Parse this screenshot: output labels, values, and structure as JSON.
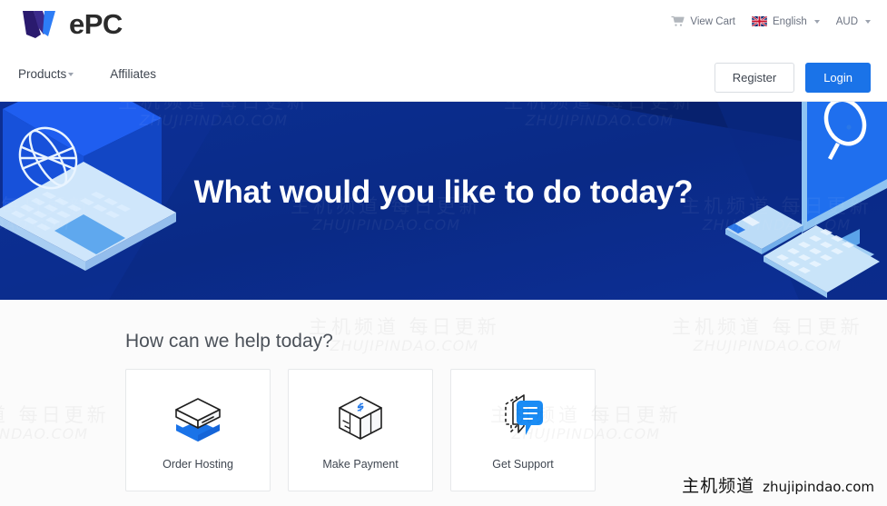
{
  "brand": {
    "logo_mark": "wepc-w-mark",
    "logo_text": "ePC",
    "accent_blue": "#1a73e8",
    "logo_purple": "#2a1a6e",
    "logo_blue": "#2d7df6"
  },
  "topbar": {
    "cart": {
      "icon": "cart-icon",
      "label": "View Cart"
    },
    "language": {
      "icon": "uk-flag-icon",
      "label": "English",
      "caret": "chevron-down-icon"
    },
    "currency": {
      "label": "AUD",
      "caret": "chevron-down-icon"
    }
  },
  "nav": {
    "links": [
      {
        "label": "Products",
        "has_caret": true
      },
      {
        "label": "Affiliates",
        "has_caret": false
      }
    ],
    "register_label": "Register",
    "login_label": "Login"
  },
  "hero": {
    "title": "What would you like to do today?",
    "background_color": "#0b2a8a",
    "left_art": "isometric-laptop-globe",
    "right_art": "isometric-desktop-search"
  },
  "main": {
    "section_title": "How can we help today?",
    "cards": [
      {
        "label": "Order Hosting",
        "icon": "server-box-icon"
      },
      {
        "label": "Make Payment",
        "icon": "cash-stack-icon"
      },
      {
        "label": "Get Support",
        "icon": "chat-bubbles-icon"
      }
    ]
  },
  "watermark": {
    "cn": "主机频道 每日更新",
    "en": "ZHUJIPINDAO.COM",
    "solid_cn": "主机频道",
    "solid_en": "zhujipindao.com"
  }
}
